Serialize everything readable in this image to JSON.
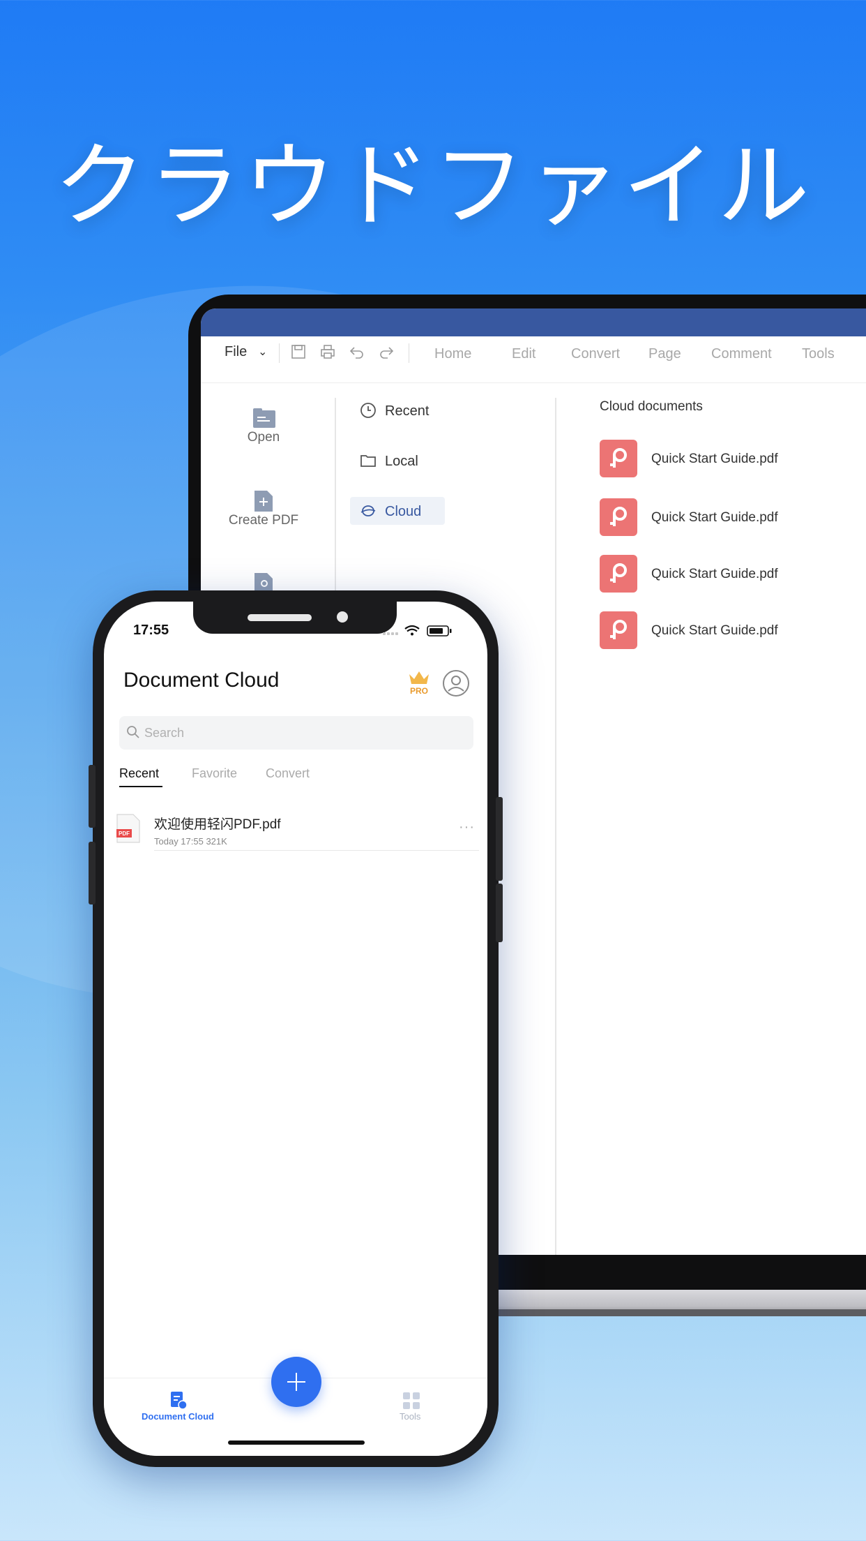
{
  "headline": "クラウドファイル",
  "desktop": {
    "menu": {
      "file": "File",
      "items": [
        "Home",
        "Edit",
        "Convert",
        "Page",
        "Comment",
        "Tools"
      ]
    },
    "left_panel": [
      {
        "label": "Open",
        "icon": "folder-icon"
      },
      {
        "label": "Create PDF",
        "icon": "create-pdf-icon"
      }
    ],
    "nav": [
      {
        "label": "Recent",
        "icon": "clock-icon"
      },
      {
        "label": "Local",
        "icon": "folder-icon"
      },
      {
        "label": "Cloud",
        "icon": "cloud-icon",
        "active": true
      }
    ],
    "cloud_title": "Cloud documents",
    "documents": [
      {
        "name": "Quick Start Guide.pdf"
      },
      {
        "name": "Quick Start Guide.pdf"
      },
      {
        "name": "Quick Start Guide.pdf"
      },
      {
        "name": "Quick Start Guide.pdf"
      }
    ],
    "accent": "#3858a0",
    "doc_icon_color": "#ec7474"
  },
  "phone": {
    "status_time": "17:55",
    "title": "Document Cloud",
    "pro_badge": "PRO",
    "search_placeholder": "Search",
    "tabs": [
      "Recent",
      "Favorite",
      "Convert"
    ],
    "active_tab": "Recent",
    "files": [
      {
        "name": "欢迎使用轻闪PDF.pdf",
        "meta": "Today 17:55 321K"
      }
    ],
    "tabbar": {
      "left": "Document Cloud",
      "right": "Tools"
    },
    "fab_color": "#2f6ff0"
  }
}
